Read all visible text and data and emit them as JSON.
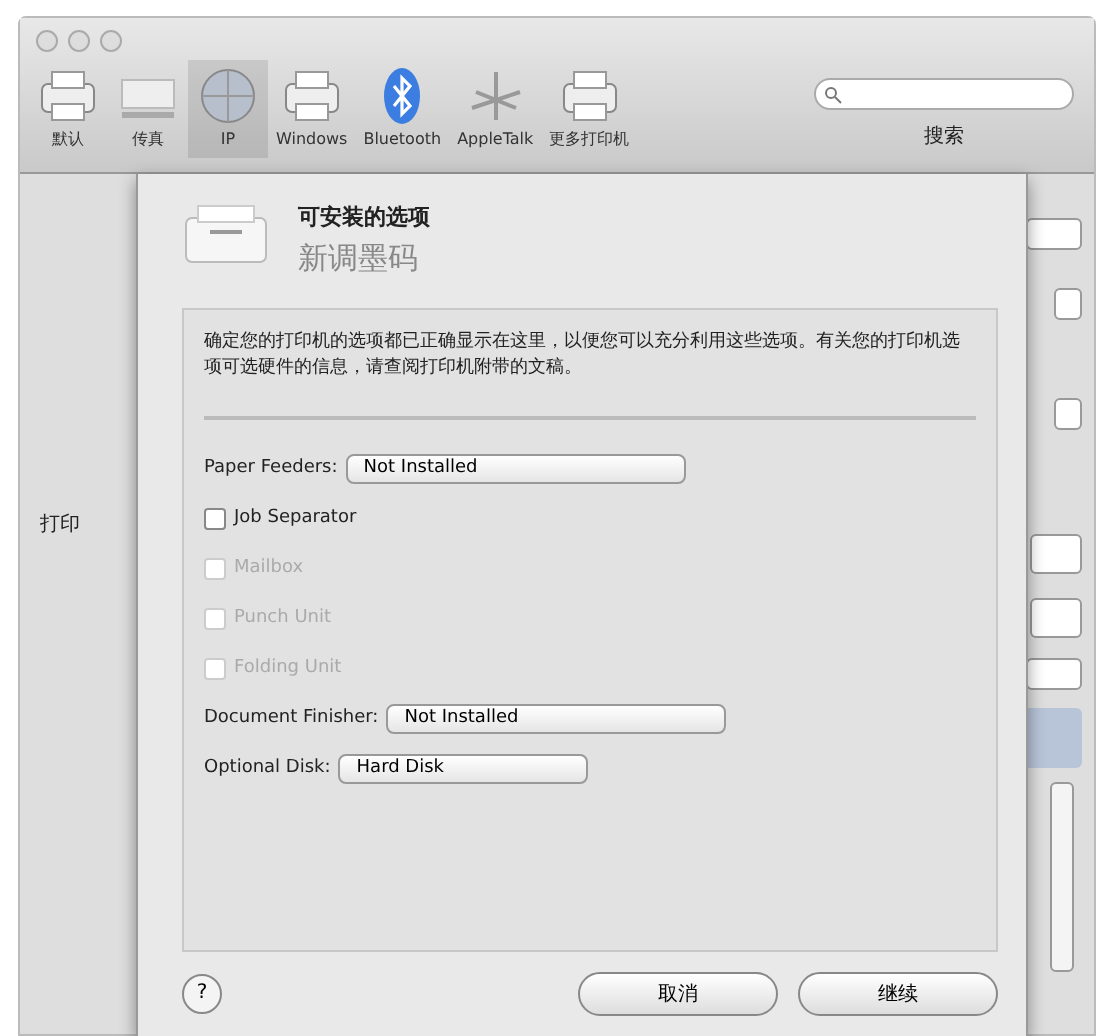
{
  "toolbar": {
    "items": [
      {
        "label": "默认",
        "kind": "printer",
        "selected": false
      },
      {
        "label": "传真",
        "kind": "fax",
        "selected": false
      },
      {
        "label": "IP",
        "kind": "globe",
        "selected": true
      },
      {
        "label": "Windows",
        "kind": "printer",
        "selected": false
      },
      {
        "label": "Bluetooth",
        "kind": "bluetooth",
        "selected": false
      },
      {
        "label": "AppleTalk",
        "kind": "network",
        "selected": false
      },
      {
        "label": "更多打印机",
        "kind": "printer",
        "selected": false
      }
    ],
    "search": {
      "label": "搜索"
    }
  },
  "background": {
    "label": "打印"
  },
  "sheet": {
    "title": "可安装的选项",
    "subtitle": "新调墨码",
    "description": "确定您的打印机的选项都已正确显示在这里，以便您可以充分利用这些选项。有关您的打印机选项可选硬件的信息，请查阅打印机附带的文稿。",
    "options": [
      {
        "kind": "popup",
        "label": "Paper Feeders:",
        "value": "Not Installed",
        "wide": true
      },
      {
        "kind": "checkbox",
        "label": "Job Separator",
        "checked": false,
        "disabled": false
      },
      {
        "kind": "checkbox",
        "label": "Mailbox",
        "checked": false,
        "disabled": true
      },
      {
        "kind": "checkbox",
        "label": "Punch Unit",
        "checked": false,
        "disabled": true
      },
      {
        "kind": "checkbox",
        "label": "Folding Unit",
        "checked": false,
        "disabled": true
      },
      {
        "kind": "popup",
        "label": "Document Finisher:",
        "value": "Not Installed",
        "wide": true
      },
      {
        "kind": "popup",
        "label": "Optional Disk:",
        "value": "Hard Disk",
        "wide": false
      }
    ],
    "help": "?",
    "buttons": [
      "取消",
      "继续"
    ]
  }
}
